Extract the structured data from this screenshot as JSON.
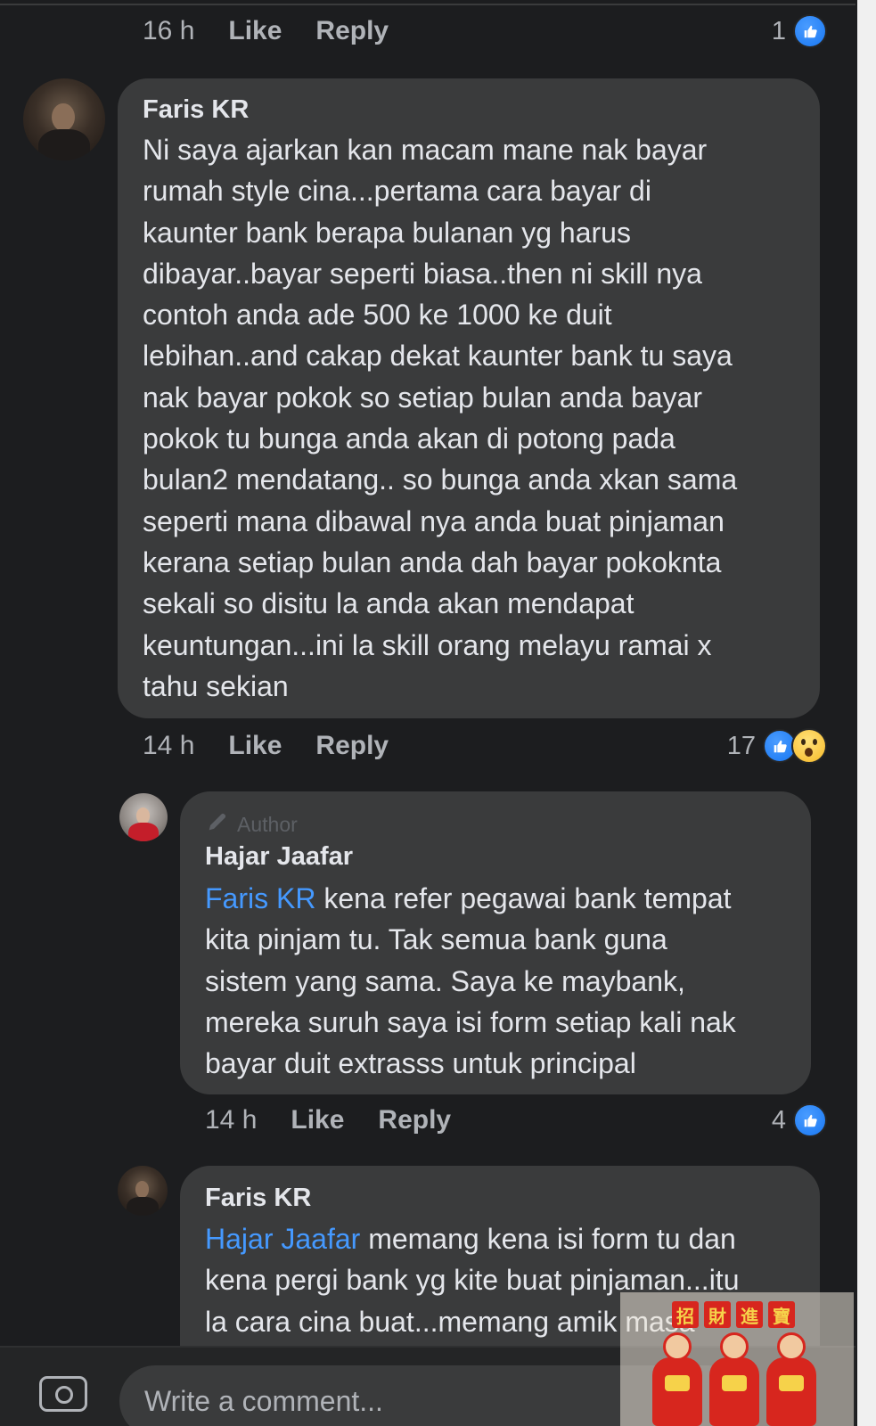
{
  "thread": {
    "prev_reply_meta": {
      "time": "16 h",
      "like_label": "Like",
      "reply_label": "Reply",
      "reaction_count": "1",
      "reactions": [
        "like-icon"
      ]
    },
    "comment_main": {
      "author": "Faris KR",
      "lines": [
        "Ni saya ajarkan kan macam mane nak bayar",
        "rumah style cina...pertama cara bayar di",
        "kaunter bank berapa bulanan yg harus",
        "dibayar..bayar seperti biasa..then ni skill nya",
        "contoh anda ade 500 ke 1000 ke duit",
        "lebihan..and cakap dekat kaunter bank tu saya",
        "nak bayar pokok so setiap bulan anda bayar",
        "pokok tu bunga anda akan di potong pada",
        "bulan2 mendatang.. so bunga anda xkan sama",
        "seperti mana dibawal nya anda buat pinjaman",
        "kerana setiap bulan anda dah bayar pokoknta",
        "sekali so disitu la anda akan mendapat",
        "keuntungan...ini la skill orang melayu ramai x",
        "tahu sekian"
      ],
      "meta": {
        "time": "14 h",
        "like_label": "Like",
        "reply_label": "Reply",
        "reaction_count": "17",
        "reactions": [
          "like-icon",
          "wow-icon"
        ]
      }
    },
    "reply_author": {
      "badge": "Author",
      "author": "Hajar Jaafar",
      "mention": "Faris KR",
      "first_line_rest": " kena refer pegawai bank tempat",
      "lines": [
        "kita pinjam tu. Tak semua bank guna",
        "sistem yang sama. Saya ke maybank,",
        "mereka suruh saya isi form setiap kali nak",
        "bayar duit extrasss untuk principal"
      ],
      "meta": {
        "time": "14 h",
        "like_label": "Like",
        "reply_label": "Reply",
        "reaction_count": "4",
        "reactions": [
          "like-icon"
        ]
      }
    },
    "reply_faris": {
      "author": "Faris KR",
      "mention": "Hajar Jaafar",
      "first_line_rest": " memang kena isi form tu dan",
      "lines": [
        "kena pergi bank yg kite buat pinjaman...itu",
        "la cara cina buat...memang amik masa"
      ]
    }
  },
  "composer": {
    "placeholder": "Write a comment...",
    "icon": "camera-icon"
  },
  "watermark": {
    "chars": [
      "招",
      "財",
      "進",
      "寶"
    ]
  },
  "colors": {
    "background": "#1c1d1f",
    "bubble": "#3a3b3c",
    "text": "#e4e6eb",
    "muted": "#b0b3b8",
    "mention": "#4599ff",
    "like": "#1877f2"
  }
}
